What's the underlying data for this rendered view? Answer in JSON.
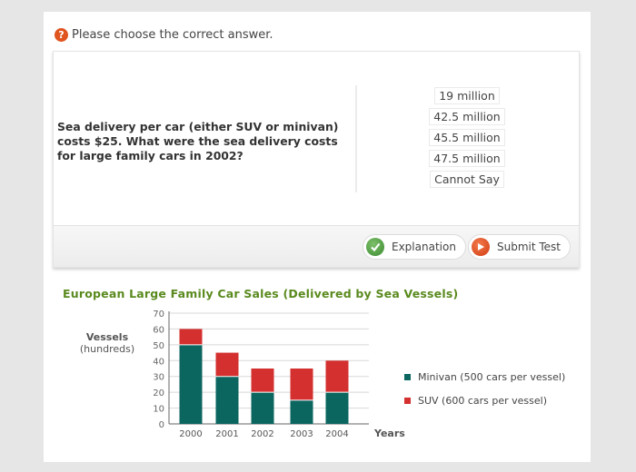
{
  "prompt": {
    "icon": "question-icon",
    "text": "Please choose the correct answer."
  },
  "question": {
    "text": "Sea delivery per car (either SUV or minivan) costs $25. What were the sea delivery costs for large family cars in 2002?"
  },
  "options": [
    {
      "label": "19 million"
    },
    {
      "label": "42.5 million"
    },
    {
      "label": "45.5 million"
    },
    {
      "label": "47.5 million"
    },
    {
      "label": "Cannot Say"
    }
  ],
  "footer": {
    "explanation_label": "Explanation",
    "explanation_icon": "check-icon",
    "submit_label": "Submit Test",
    "submit_icon": "play-icon"
  },
  "colors": {
    "minivan": "#0b6660",
    "suv": "#d3302f",
    "title": "#5a8a1e",
    "question_icon": "#e0541f"
  },
  "chart_data": {
    "type": "bar",
    "stacked": true,
    "title": "European Large Family Car Sales (Delivered by Sea Vessels)",
    "xlabel": "Years",
    "ylabel": "Vessels",
    "ylabel_sub": "(hundreds)",
    "categories": [
      "2000",
      "2001",
      "2002",
      "2003",
      "2004"
    ],
    "series": [
      {
        "name": "Minivan (500 cars per vessel)",
        "values": [
          50,
          30,
          20,
          15,
          20
        ]
      },
      {
        "name": "SUV (600 cars per vessel)",
        "values": [
          10,
          15,
          15,
          20,
          20
        ]
      }
    ],
    "ylim": [
      0,
      70
    ],
    "yticks": [
      0,
      10,
      20,
      30,
      40,
      50,
      60,
      70
    ],
    "grid": true,
    "legend_position": "right"
  }
}
